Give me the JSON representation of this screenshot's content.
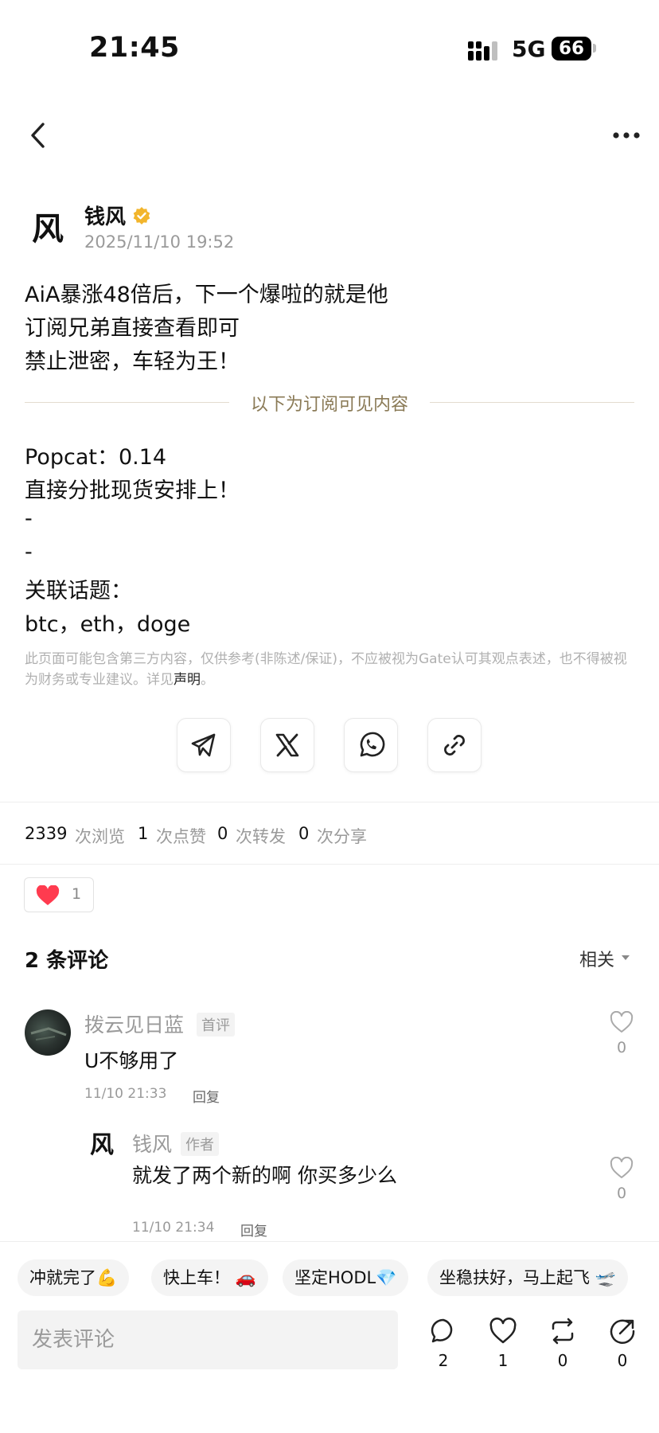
{
  "status_bar": {
    "time": "21:45",
    "network": "5G",
    "battery": "66"
  },
  "author": {
    "avatar_char": "风",
    "name": "钱风",
    "time": "2025/11/10 19:52"
  },
  "post": {
    "lines_top": [
      "AiA暴涨48倍后，下一个爆啦的就是他",
      "订阅兄弟直接查看即可",
      "禁止泄密，车轻为王！"
    ],
    "divider_text": "以下为订阅可见内容",
    "lines_bottom": [
      "Popcat：0.14",
      "直接分批现货安排上！",
      "-",
      "-",
      "关联话题：",
      "btc，eth，doge"
    ]
  },
  "disclaimer": {
    "text": "此页面可能包含第三方内容，仅供参考(非陈述/保证)，不应被视为Gate认可其观点表述，也不得被视为财务或专业建议。详见",
    "link": "声明",
    "end": "。"
  },
  "share_icons": [
    "telegram-icon",
    "x-icon",
    "whatsapp-icon",
    "link-icon"
  ],
  "stats": [
    {
      "num": "2339",
      "label": "次浏览"
    },
    {
      "num": "1",
      "label": "次点赞"
    },
    {
      "num": "0",
      "label": "次转发"
    },
    {
      "num": "0",
      "label": "次分享"
    }
  ],
  "reaction": {
    "count": "1",
    "color": "#ff3b4f"
  },
  "comments": {
    "title": "2 条评论",
    "sort": "相关",
    "items": [
      {
        "name": "拨云见日蓝",
        "badge": "首评",
        "text": "U不够用了",
        "time": "11/10 21:33",
        "reply": "回复",
        "likes": "0"
      },
      {
        "avatar_char": "风",
        "name": "钱风",
        "badge": "作者",
        "text": "就发了两个新的啊 你买多少么",
        "time": "11/10 21:34",
        "reply": "回复",
        "likes": "0"
      }
    ]
  },
  "quick_replies": [
    "冲就完了💪",
    "快上车！ 🚗",
    "坚定HODL💎",
    "坐稳扶好，马上起飞 🛫"
  ],
  "bottom_bar": {
    "placeholder": "发表评论",
    "counts": {
      "comments": "2",
      "likes": "1",
      "reposts": "0",
      "shares": "0"
    }
  }
}
